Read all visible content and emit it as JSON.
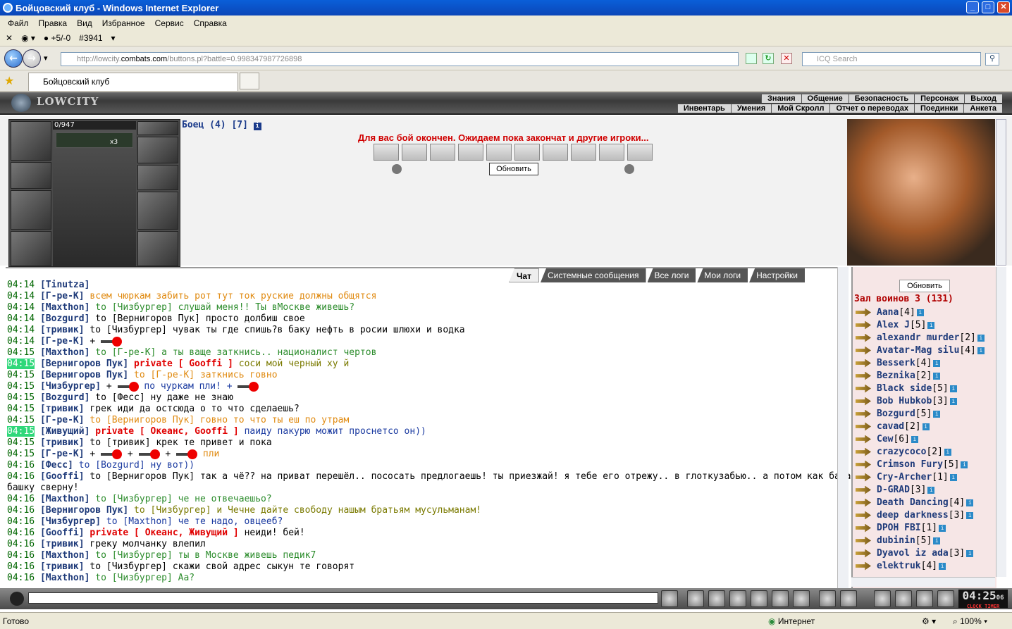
{
  "window": {
    "title": "Бойцовский клуб - Windows Internet Explorer"
  },
  "menu": [
    "Файл",
    "Правка",
    "Вид",
    "Избранное",
    "Сервис",
    "Справка"
  ],
  "linkbar": {
    "counter": "+5/-0",
    "id": "#3941"
  },
  "address": {
    "url_prefix": "http://lowcity.",
    "url_domain": "combats.com",
    "url_suffix": "/buttons.pl?battle=0.998347987726898",
    "search_placeholder": "ICQ Search"
  },
  "tabs": [
    {
      "label": "Бойцовский клуб"
    }
  ],
  "game": {
    "logo": "LOWCITY",
    "nav_top": [
      "Знания",
      "Общение",
      "Безопасность",
      "Персонаж",
      "Выход"
    ],
    "nav_bottom": [
      "Инвентарь",
      "Умения",
      "Мой Скролл",
      "Отчет о переводах",
      "Поединки",
      "Анкета"
    ],
    "hp": "0/947",
    "x_count": "x3",
    "fighter_title": "Боец (4) [7]",
    "battle_message": "Для вас бой окончен. Ожидаем пока закончат и другие игроки...",
    "refresh_label": "Обновить"
  },
  "chat_tabs": [
    "Чат",
    "Системные сообщения",
    "Все логи",
    "Мои логи",
    "Настройки"
  ],
  "chat": [
    {
      "time": "04:14",
      "nick": "[Tinutza]",
      "parts": []
    },
    {
      "time": "04:14",
      "nick": "[Г-ре-К]",
      "parts": [
        {
          "c": "msg-or",
          "t": "всем чюркам забить рот тут ток руские должны общятся"
        }
      ]
    },
    {
      "time": "04:14",
      "nick": "[Maxthon]",
      "parts": [
        {
          "c": "to",
          "t": "to [Чизбургер] слушай меня!! Ты вМоскве живешь?"
        }
      ]
    },
    {
      "time": "04:14",
      "nick": "[Bozgurd]",
      "parts": [
        {
          "c": "",
          "t": "to [Вернигоров Пук] просто долбиш свое"
        }
      ]
    },
    {
      "time": "04:14",
      "nick": "[тривик]",
      "parts": [
        {
          "c": "",
          "t": "to [Чизбургер] чувак ты где спишь?в баку нефть в росии шлюхи и водка"
        }
      ]
    },
    {
      "time": "04:14",
      "nick": "[Г-ре-К]",
      "parts": [
        {
          "c": "",
          "t": "+"
        },
        {
          "c": "icon",
          "t": ""
        }
      ]
    },
    {
      "time": "04:15",
      "nick": "[Maxthon]",
      "parts": [
        {
          "c": "to",
          "t": "to [Г-ре-К] а ты ваще заткнись.. националист чертов"
        }
      ]
    },
    {
      "time": "04:15",
      "hl": true,
      "nick": "[Вернигоров Пук]",
      "parts": [
        {
          "c": "pm",
          "t": "private [ Gooffi ]"
        },
        {
          "c": "msg-ol",
          "t": "соси мой черный ху й"
        }
      ]
    },
    {
      "time": "04:15",
      "nick": "[Вернигоров Пук]",
      "parts": [
        {
          "c": "msg-or",
          "t": "to [Г-ре-К] заткнись говно"
        }
      ]
    },
    {
      "time": "04:15",
      "nick": "[Чизбургер]",
      "parts": [
        {
          "c": "",
          "t": "+"
        },
        {
          "c": "icon",
          "t": ""
        },
        {
          "c": "msg-bl",
          "t": "по чуркам пли! +"
        },
        {
          "c": "icon",
          "t": ""
        }
      ]
    },
    {
      "time": "04:15",
      "nick": "[Bozgurd]",
      "parts": [
        {
          "c": "",
          "t": "to [Фесс] ну даже не знаю"
        }
      ]
    },
    {
      "time": "04:15",
      "nick": "[тривик]",
      "parts": [
        {
          "c": "",
          "t": "грек иди да остсюда о то что сделаешь?"
        }
      ]
    },
    {
      "time": "04:15",
      "nick": "[Г-ре-К]",
      "parts": [
        {
          "c": "msg-or",
          "t": "to [Вернигоров Пук] говно то что ты еш по утрам"
        }
      ]
    },
    {
      "time": "04:15",
      "hl": true,
      "nick": "[Живущий]",
      "parts": [
        {
          "c": "pm",
          "t": "private [ Океанс, Gooffi ]"
        },
        {
          "c": "msg-bl",
          "t": "паиду пакурю можит проснетсо он))"
        }
      ]
    },
    {
      "time": "04:15",
      "nick": "[тривик]",
      "parts": [
        {
          "c": "",
          "t": "to [тривик] крек те привет и пока"
        }
      ]
    },
    {
      "time": "04:15",
      "nick": "[Г-ре-К]",
      "parts": [
        {
          "c": "",
          "t": "+"
        },
        {
          "c": "icon",
          "t": ""
        },
        {
          "c": "",
          "t": "+"
        },
        {
          "c": "icon",
          "t": ""
        },
        {
          "c": "",
          "t": "+"
        },
        {
          "c": "icon",
          "t": ""
        },
        {
          "c": "msg-or",
          "t": "пли"
        }
      ]
    },
    {
      "time": "04:16",
      "nick": "[Фесс]",
      "parts": [
        {
          "c": "msg-bl",
          "t": "to [Bozgurd] ну вот))"
        }
      ]
    },
    {
      "time": "04:16",
      "nick": "[Gooffi]",
      "parts": [
        {
          "c": "",
          "t": "to [Вернигоров Пук] так а чё?? на приват перешёл.. пососать предлогаешь! ты приезжай! я тебе его отрежу.. в глоткузабью.. а потом как барану в"
        }
      ]
    },
    {
      "time": "",
      "nick": "",
      "parts": [
        {
          "c": "",
          "t": "башку свернy!"
        }
      ]
    },
    {
      "time": "04:16",
      "nick": "[Maxthon]",
      "parts": [
        {
          "c": "to",
          "t": "to [Чизбургер] че не отвечаешьо?"
        }
      ]
    },
    {
      "time": "04:16",
      "nick": "[Вернигоров Пук]",
      "parts": [
        {
          "c": "msg-ol",
          "t": "to [Чизбургер] и Чечне дайте свободу нашым братьям мусульманам!"
        }
      ]
    },
    {
      "time": "04:16",
      "nick": "[Чизбургер]",
      "parts": [
        {
          "c": "msg-bl",
          "t": "to [Maxthon] че те надо, овцееб?"
        }
      ]
    },
    {
      "time": "04:16",
      "nick": "[Gooffi]",
      "parts": [
        {
          "c": "pm",
          "t": "private [ Океанс, Живущий ]"
        },
        {
          "c": "",
          "t": "неиди! бей!"
        }
      ]
    },
    {
      "time": "04:16",
      "nick": "[тривик]",
      "parts": [
        {
          "c": "",
          "t": "греку молчанку влепил"
        }
      ]
    },
    {
      "time": "04:16",
      "nick": "[Maxthon]",
      "parts": [
        {
          "c": "to",
          "t": "to [Чизбургер] ты в Москве живешь педик7"
        }
      ]
    },
    {
      "time": "04:16",
      "nick": "[тривик]",
      "parts": [
        {
          "c": "",
          "t": "to [Чизбургер] скажи свой адрес сыкун те говорят"
        }
      ]
    },
    {
      "time": "04:16",
      "nick": "[Maxthon]",
      "parts": [
        {
          "c": "to",
          "t": "to [Чизбургер] Аа?"
        }
      ]
    }
  ],
  "userlist": {
    "refresh": "Обновить",
    "hall": "Зал воинов 3 (131)",
    "users": [
      {
        "name": "Aana",
        "lvl": "[4]"
      },
      {
        "name": "Alex J",
        "lvl": "[5]"
      },
      {
        "name": "alexandr murder",
        "lvl": "[2]"
      },
      {
        "name": "Avatar-Mag silu",
        "lvl": "[4]"
      },
      {
        "name": "Besserk",
        "lvl": "[4]"
      },
      {
        "name": "Beznika",
        "lvl": "[2]"
      },
      {
        "name": "Black side",
        "lvl": "[5]"
      },
      {
        "name": "Bob Hubkob",
        "lvl": "[3]"
      },
      {
        "name": "Bozgurd",
        "lvl": "[5]"
      },
      {
        "name": "cavad",
        "lvl": "[2]"
      },
      {
        "name": "Cew",
        "lvl": "[6]"
      },
      {
        "name": "crazycoco",
        "lvl": "[2]"
      },
      {
        "name": "Crimson Fury",
        "lvl": "[5]"
      },
      {
        "name": "Cry-Archer",
        "lvl": "[1]"
      },
      {
        "name": "D-GRAD",
        "lvl": "[3]"
      },
      {
        "name": "Death Dancing",
        "lvl": "[4]"
      },
      {
        "name": "deep darkness",
        "lvl": "[3]"
      },
      {
        "name": "DPOH FBI",
        "lvl": "[1]"
      },
      {
        "name": "dubinin",
        "lvl": "[5]"
      },
      {
        "name": "Dyavol iz ada",
        "lvl": "[3]"
      },
      {
        "name": "elektruk",
        "lvl": "[4]"
      }
    ]
  },
  "clock": {
    "time": "04:25",
    "sec": "06",
    "labels": "CLOCK TIMER"
  },
  "status": {
    "left": "Готово",
    "zone": "Интернет",
    "zoom": "100%"
  },
  "colors": {
    "title_bar": "#0b46b8",
    "highlight_time": "#2fd87a",
    "private": "#e00000",
    "hall": "#b00000"
  }
}
